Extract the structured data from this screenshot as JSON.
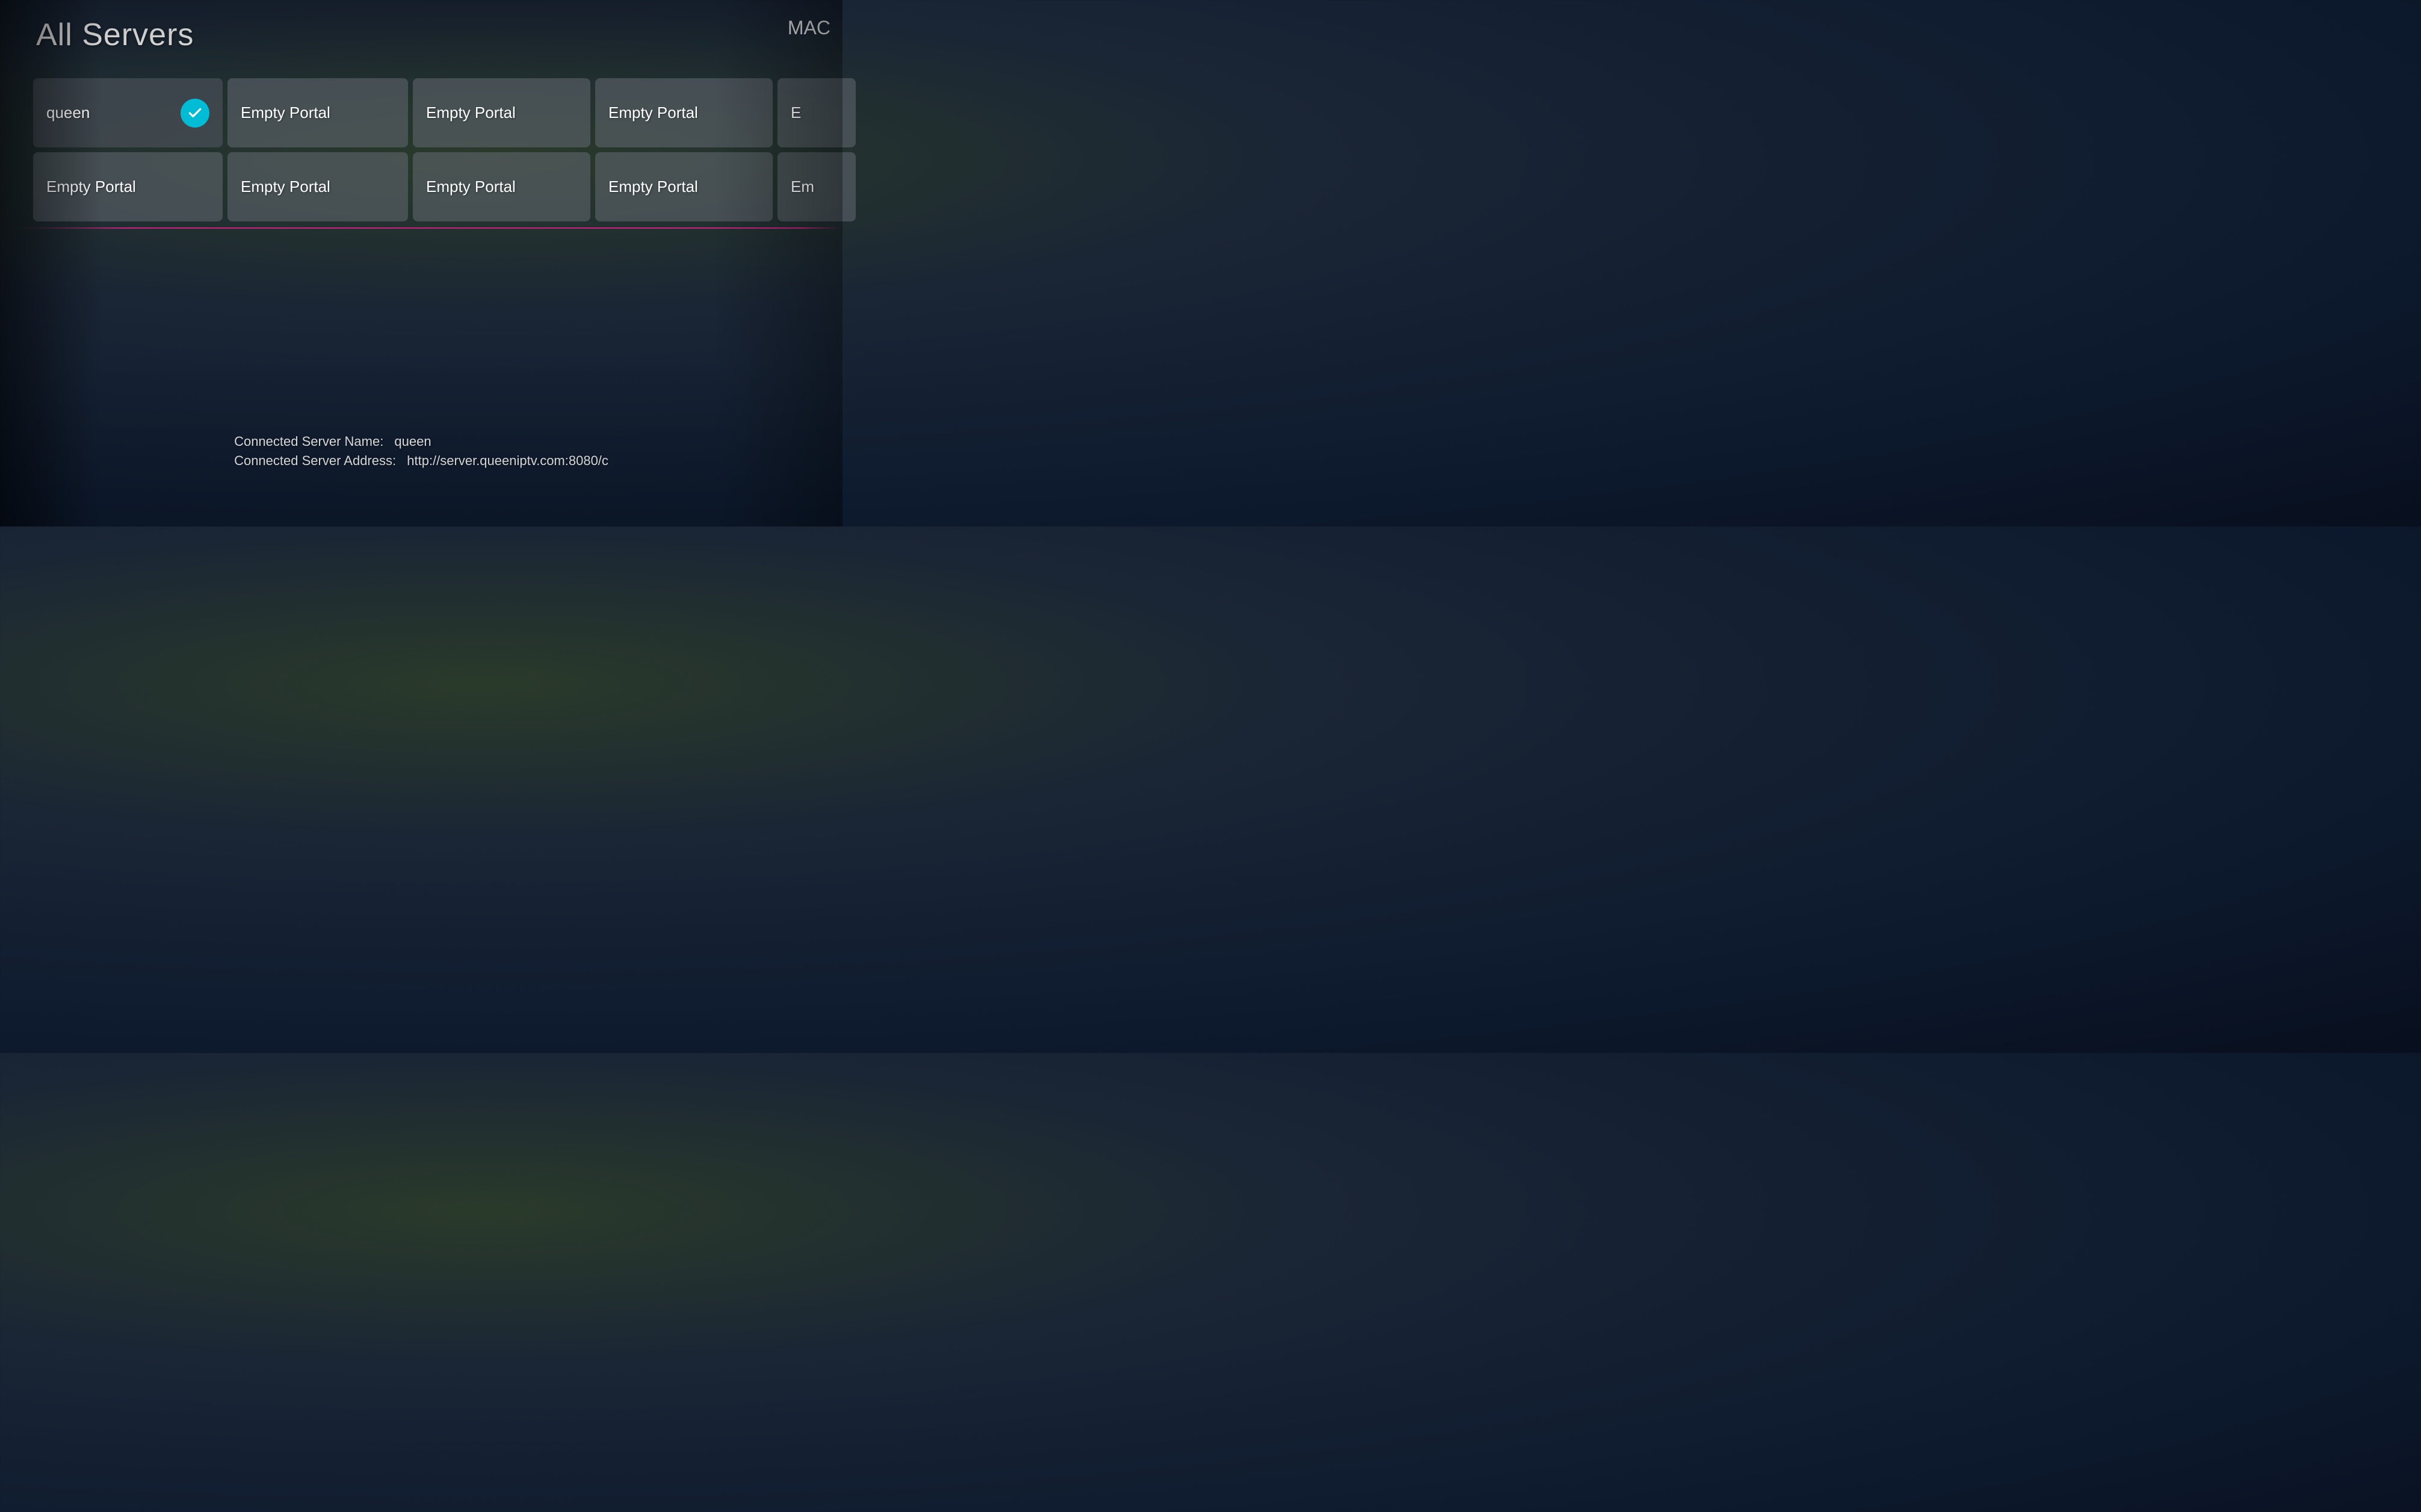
{
  "header": {
    "title": "All Servers",
    "mac_label": "MAC"
  },
  "grid": {
    "rows": [
      [
        {
          "id": "queen",
          "label": "queen",
          "active": true,
          "partial": false
        },
        {
          "id": "empty1",
          "label": "Empty Portal",
          "active": false,
          "partial": false
        },
        {
          "id": "empty2",
          "label": "Empty Portal",
          "active": false,
          "partial": false
        },
        {
          "id": "empty3",
          "label": "Empty Portal",
          "active": false,
          "partial": false
        },
        {
          "id": "empty4-partial",
          "label": "E",
          "active": false,
          "partial": true
        }
      ],
      [
        {
          "id": "empty5",
          "label": "Empty Portal",
          "active": false,
          "partial": false
        },
        {
          "id": "empty6",
          "label": "Empty Portal",
          "active": false,
          "partial": false
        },
        {
          "id": "empty7",
          "label": "Empty Portal",
          "active": false,
          "partial": false
        },
        {
          "id": "empty8",
          "label": "Empty Portal",
          "active": false,
          "partial": false
        },
        {
          "id": "empty9-partial",
          "label": "Em",
          "active": false,
          "partial": true
        }
      ]
    ]
  },
  "footer": {
    "server_name_label": "Connected Server Name:",
    "server_name_value": "queen",
    "server_address_label": "Connected Server Address:",
    "server_address_value": "http://server.queeniptv.com:8080/c"
  }
}
